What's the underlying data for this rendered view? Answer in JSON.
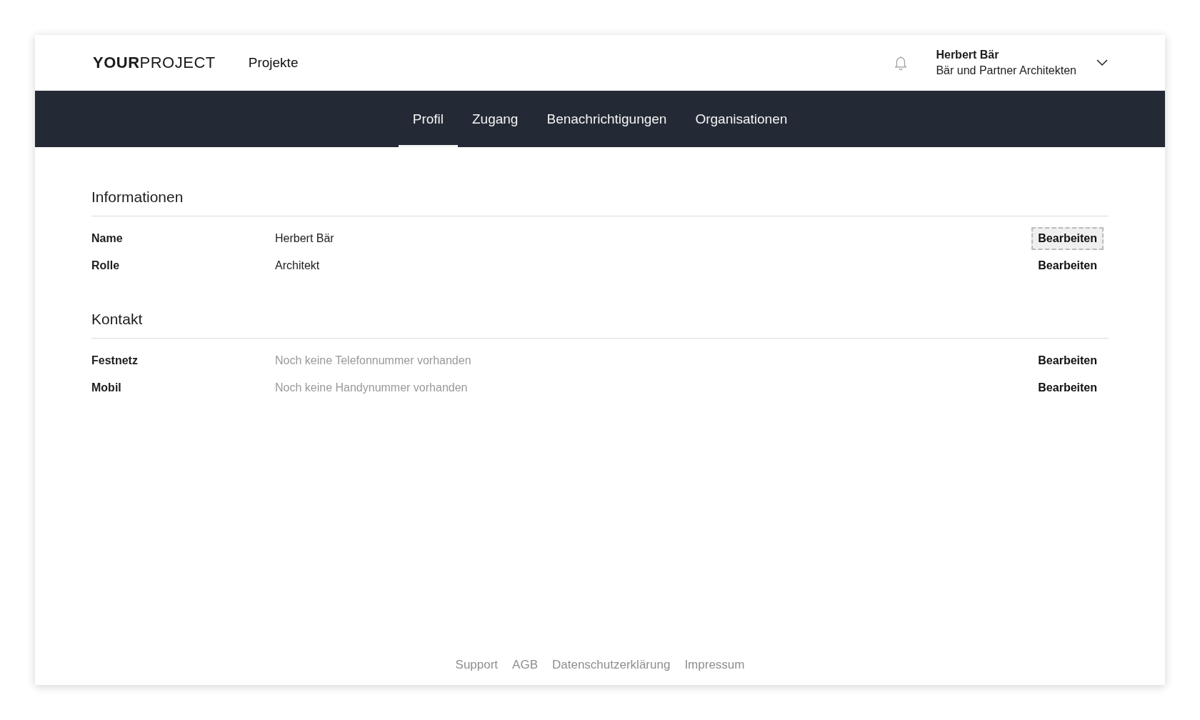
{
  "header": {
    "logo": "**YOUR**PROJECT",
    "nav_link": "Projekte",
    "user": {
      "name": "Herbert Bär",
      "organization": "Bär und Partner Architekten"
    }
  },
  "tabs": [
    {
      "label": "Profil",
      "selected": true
    },
    {
      "label": "Zugang",
      "selected": false
    },
    {
      "label": "Benachrichtigungen",
      "selected": false
    },
    {
      "label": "Organisationen",
      "selected": false
    }
  ],
  "sections": [
    {
      "title": "Informationen",
      "rows": [
        {
          "label": "Name",
          "value": "Herbert Bär",
          "action": "Bearbeiten",
          "focused": true
        },
        {
          "label": "Rolle",
          "value": "Architekt",
          "action": "Bearbeiten",
          "focused": false
        }
      ]
    },
    {
      "title": "Kontakt",
      "rows": [
        {
          "label": "Festnetz",
          "placeholder": "Noch keine Telefonnummer vorhanden",
          "action": "Bearbeiten",
          "focused": false
        },
        {
          "label": "Mobil",
          "placeholder": "Noch keine Handynummer vorhanden",
          "action": "Bearbeiten",
          "focused": false
        }
      ]
    }
  ],
  "footer": {
    "links": [
      "Support",
      "AGB",
      "Datenschutzerklärung",
      "Impressum"
    ]
  }
}
